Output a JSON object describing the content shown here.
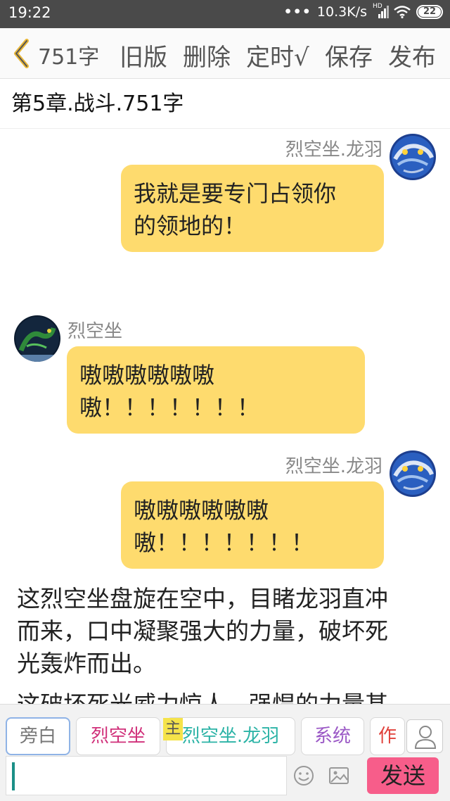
{
  "status_bar": {
    "time": "19:22",
    "network_speed": "10.3K/s",
    "network_badge": "HD",
    "battery": "22"
  },
  "toolbar": {
    "word_count": "751字",
    "old_version": "旧版",
    "delete": "删除",
    "schedule": "定时√",
    "save": "保存",
    "publish": "发布"
  },
  "chapter": {
    "title": "第5章.战斗.751字"
  },
  "messages": [
    {
      "side": "right",
      "speaker": "烈空坐.龙羽",
      "avatar": "blue-dragon-avatar",
      "lines": [
        "我就是要专门占领你",
        "的领地的！"
      ]
    },
    {
      "side": "left",
      "speaker": "烈空坐",
      "avatar": "green-dragon-avatar",
      "lines": [
        "嗷嗷嗷嗷嗷嗷",
        "嗷！！！！！！！"
      ]
    },
    {
      "side": "right",
      "speaker": "烈空坐.龙羽",
      "avatar": "blue-dragon-avatar",
      "lines": [
        "嗷嗷嗷嗷嗷嗷",
        "嗷！！！！！！！"
      ]
    }
  ],
  "narration": [
    [
      "这烈空坐盘旋在空中，目睹龙羽直冲",
      "而来，口中凝聚强大的力量，破坏死",
      "光轰炸而出。"
    ],
    [
      "这破坏死光威力惊人，强悍的力量甚"
    ]
  ],
  "roles": [
    {
      "label": "旁白",
      "color": "#777777"
    },
    {
      "label": "烈空坐",
      "color": "#d0307a"
    },
    {
      "label": "烈空坐.龙羽",
      "color": "#2bb3a6"
    },
    {
      "label": "系统",
      "color": "#9b59c6"
    },
    {
      "label": "作",
      "color": "#e0403a"
    }
  ],
  "main_badge": "主",
  "composer": {
    "send_label": "发送"
  },
  "icons": {
    "back": "chevron-left-icon",
    "user": "user-icon",
    "emoji": "smiley-icon",
    "image": "image-icon",
    "wifi": "wifi-icon",
    "signal": "signal-icon",
    "battery": "battery-icon"
  },
  "colors": {
    "bubble": "#fedb6e",
    "send": "#f75d8a",
    "status_bar": "#4a4a4a"
  }
}
